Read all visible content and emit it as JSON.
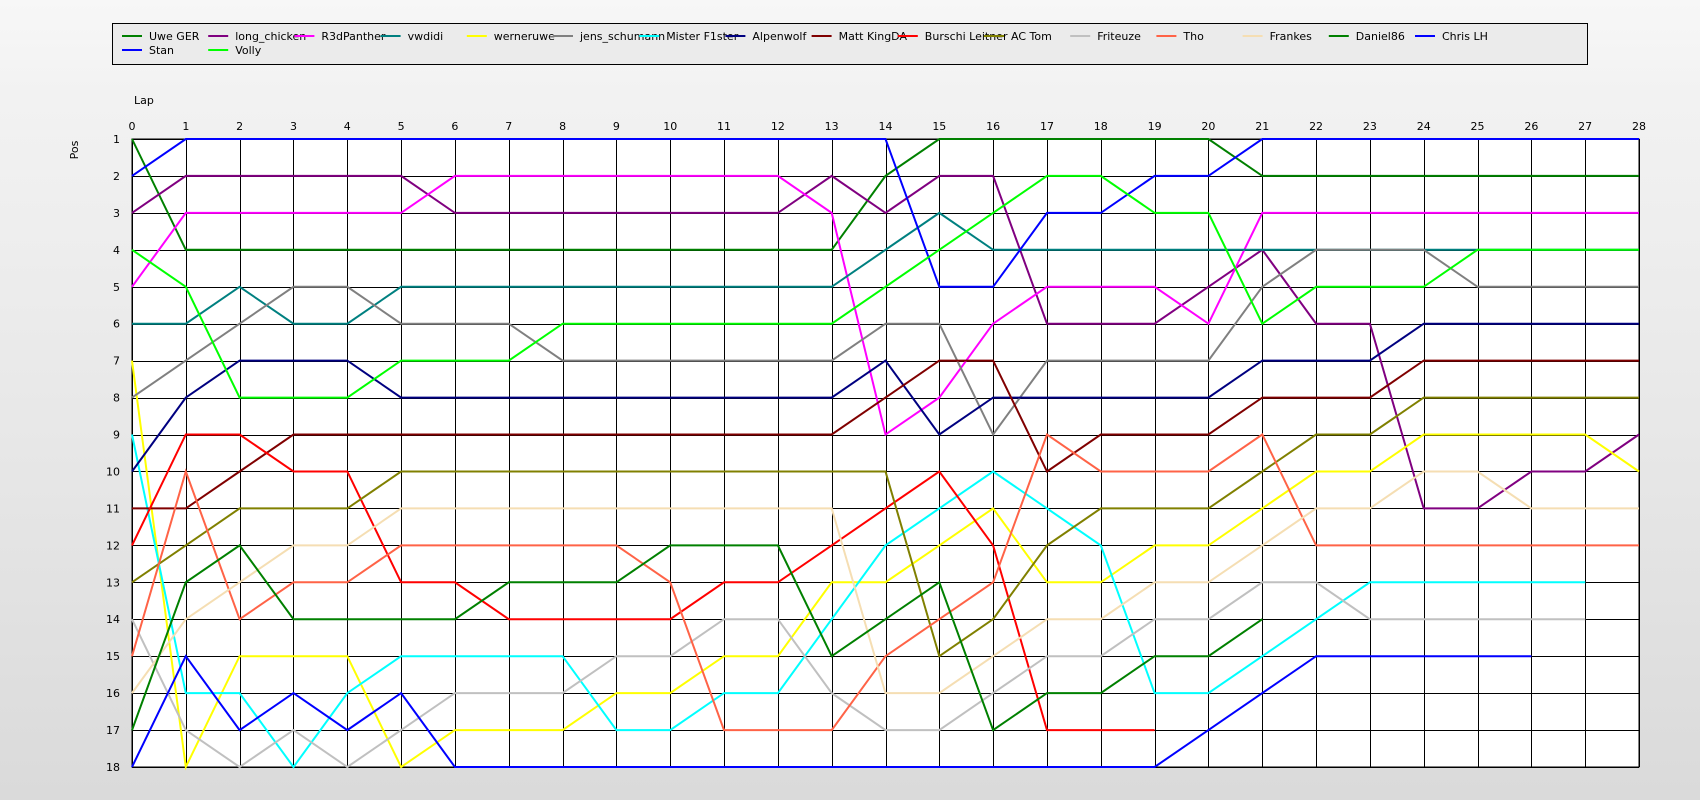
{
  "chart_data": {
    "type": "line",
    "xlabel": "Lap",
    "ylabel": "Pos",
    "x": [
      0,
      1,
      2,
      3,
      4,
      5,
      6,
      7,
      8,
      9,
      10,
      11,
      12,
      13,
      14,
      15,
      16,
      17,
      18,
      19,
      20,
      21,
      22,
      23,
      24,
      25,
      26,
      27,
      28
    ],
    "xlim": [
      0,
      28
    ],
    "ylim": [
      1,
      18
    ],
    "y_inverted": true,
    "y_ticks": [
      1,
      2,
      3,
      4,
      5,
      6,
      7,
      8,
      9,
      10,
      11,
      12,
      13,
      14,
      15,
      16,
      17,
      18
    ],
    "grid": true,
    "legend_position": "top",
    "series": [
      {
        "name": "Uwe GER",
        "color": "#008000",
        "values": [
          1,
          4,
          4,
          4,
          4,
          4,
          4,
          4,
          4,
          4,
          4,
          4,
          4,
          4,
          2,
          1,
          1,
          1,
          1,
          1,
          1,
          2,
          2,
          2,
          2,
          2,
          2,
          2,
          2
        ]
      },
      {
        "name": "long_chicken",
        "color": "#800080",
        "values": [
          3,
          2,
          2,
          2,
          2,
          2,
          3,
          3,
          3,
          3,
          3,
          3,
          3,
          2,
          3,
          2,
          2,
          6,
          6,
          6,
          5,
          4,
          6,
          6,
          11,
          11,
          10,
          10,
          9
        ]
      },
      {
        "name": "R3dPanther",
        "color": "#FF00FF",
        "values": [
          5,
          3,
          3,
          3,
          3,
          3,
          2,
          2,
          2,
          2,
          2,
          2,
          2,
          3,
          9,
          8,
          6,
          5,
          5,
          5,
          6,
          3,
          3,
          3,
          3,
          3,
          3,
          3,
          3
        ]
      },
      {
        "name": "vwdidi",
        "color": "#008080",
        "values": [
          6,
          6,
          5,
          6,
          6,
          5,
          5,
          5,
          5,
          5,
          5,
          5,
          5,
          5,
          4,
          3,
          4,
          4,
          4,
          4,
          4,
          4,
          4,
          4,
          4,
          4,
          4,
          4,
          4
        ]
      },
      {
        "name": "werneruwe",
        "color": "#FFFF00",
        "values": [
          7,
          18,
          15,
          15,
          15,
          18,
          17,
          17,
          17,
          16,
          16,
          15,
          15,
          13,
          13,
          12,
          11,
          13,
          13,
          12,
          12,
          11,
          10,
          10,
          9,
          9,
          9,
          9,
          10
        ]
      },
      {
        "name": "jens_schumann",
        "color": "#808080",
        "values": [
          8,
          7,
          6,
          5,
          5,
          6,
          6,
          6,
          7,
          7,
          7,
          7,
          7,
          7,
          6,
          6,
          9,
          7,
          7,
          7,
          7,
          5,
          4,
          4,
          4,
          5,
          5,
          5,
          5
        ]
      },
      {
        "name": "Mister F1ster",
        "color": "#00FFFF",
        "values": [
          9,
          16,
          16,
          18,
          16,
          15,
          15,
          15,
          15,
          17,
          17,
          16,
          16,
          14,
          12,
          11,
          10,
          11,
          12,
          16,
          16,
          15,
          14,
          13,
          13,
          13,
          13,
          13,
          null
        ]
      },
      {
        "name": "Alpenwolf",
        "color": "#000080",
        "values": [
          10,
          8,
          7,
          7,
          7,
          8,
          8,
          8,
          8,
          8,
          8,
          8,
          8,
          8,
          7,
          9,
          8,
          8,
          8,
          8,
          8,
          7,
          7,
          7,
          6,
          6,
          6,
          6,
          6
        ]
      },
      {
        "name": "Matt KingDA",
        "color": "#800000",
        "values": [
          11,
          11,
          10,
          9,
          9,
          9,
          9,
          9,
          9,
          9,
          9,
          9,
          9,
          9,
          8,
          7,
          7,
          10,
          9,
          9,
          9,
          8,
          8,
          8,
          7,
          7,
          7,
          7,
          7
        ]
      },
      {
        "name": "Burschi Leitner",
        "color": "#FF0000",
        "values": [
          12,
          9,
          9,
          10,
          10,
          13,
          13,
          14,
          14,
          14,
          14,
          13,
          13,
          12,
          11,
          10,
          12,
          17,
          17,
          17,
          null,
          null,
          null,
          null,
          null,
          null,
          null,
          null,
          null
        ]
      },
      {
        "name": "AC Tom",
        "color": "#808000",
        "values": [
          13,
          12,
          11,
          11,
          11,
          10,
          10,
          10,
          10,
          10,
          10,
          10,
          10,
          10,
          10,
          15,
          14,
          12,
          11,
          11,
          11,
          10,
          9,
          9,
          8,
          8,
          8,
          8,
          8
        ]
      },
      {
        "name": "Friteuze",
        "color": "#C0C0C0",
        "values": [
          14,
          17,
          18,
          17,
          18,
          17,
          16,
          16,
          16,
          15,
          15,
          14,
          14,
          16,
          17,
          17,
          16,
          15,
          15,
          14,
          14,
          13,
          13,
          14,
          14,
          14,
          14,
          14,
          null
        ]
      },
      {
        "name": "Tho",
        "color": "#FF6347",
        "values": [
          15,
          10,
          14,
          13,
          13,
          12,
          12,
          12,
          12,
          12,
          13,
          17,
          17,
          17,
          15,
          14,
          13,
          9,
          10,
          10,
          10,
          9,
          12,
          12,
          12,
          12,
          12,
          12,
          12
        ]
      },
      {
        "name": "Frankes",
        "color": "#F5DEB3",
        "values": [
          16,
          14,
          13,
          12,
          12,
          11,
          11,
          11,
          11,
          11,
          11,
          11,
          11,
          11,
          16,
          16,
          15,
          14,
          14,
          13,
          13,
          12,
          11,
          11,
          10,
          10,
          11,
          11,
          11
        ]
      },
      {
        "name": "Daniel86",
        "color": "#008000",
        "values": [
          17,
          13,
          12,
          14,
          14,
          14,
          14,
          13,
          13,
          13,
          12,
          12,
          12,
          15,
          14,
          13,
          17,
          16,
          16,
          15,
          15,
          14,
          null,
          null,
          null,
          null,
          null,
          null,
          null
        ]
      },
      {
        "name": "Chris LH",
        "color": "#0000FF",
        "values": [
          2,
          1,
          1,
          1,
          1,
          1,
          1,
          1,
          1,
          1,
          1,
          1,
          1,
          1,
          1,
          5,
          5,
          3,
          3,
          2,
          2,
          1,
          1,
          1,
          1,
          1,
          1,
          1,
          1
        ]
      },
      {
        "name": "Stan",
        "color": "#0000FF",
        "values": [
          18,
          15,
          17,
          16,
          17,
          16,
          18,
          18,
          18,
          18,
          18,
          18,
          18,
          18,
          18,
          18,
          18,
          18,
          18,
          18,
          17,
          16,
          15,
          15,
          15,
          15,
          15,
          null,
          null
        ]
      },
      {
        "name": "Volly",
        "color": "#00FF00",
        "values": [
          4,
          5,
          8,
          8,
          8,
          7,
          7,
          7,
          6,
          6,
          6,
          6,
          6,
          6,
          5,
          4,
          3,
          2,
          2,
          3,
          3,
          6,
          5,
          5,
          5,
          4,
          4,
          4,
          4
        ]
      }
    ]
  }
}
